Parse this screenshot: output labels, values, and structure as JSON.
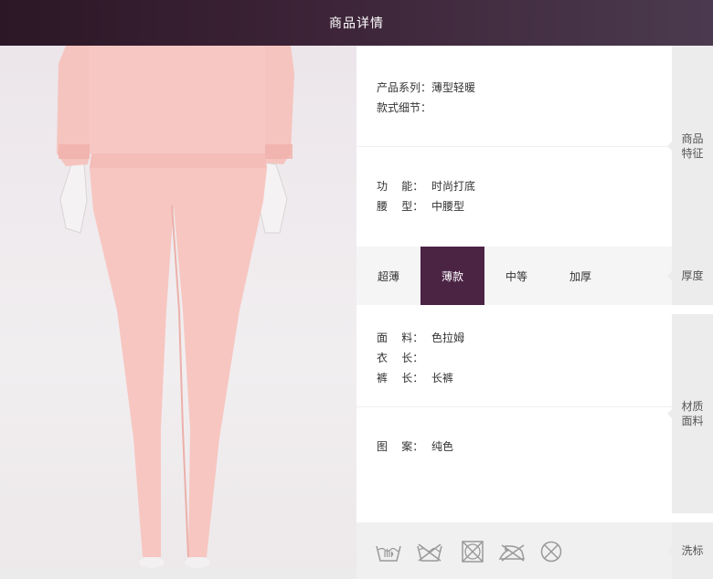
{
  "header": {
    "title": "商品详情"
  },
  "features": {
    "side_label": "商品\n特征",
    "series": {
      "label": "产品系列：",
      "value": "薄型轻暖"
    },
    "detail": {
      "label": "款式细节：",
      "value": ""
    },
    "function": {
      "label": "功    能：",
      "value": "时尚打底"
    },
    "waist": {
      "label": "腰    型：",
      "value": "中腰型"
    }
  },
  "thickness": {
    "side_label": "厚度",
    "options": [
      "超薄",
      "薄款",
      "中等",
      "加厚"
    ],
    "selected": "薄款"
  },
  "material": {
    "side_label": "材质\n面料",
    "fabric": {
      "label": "面    料：",
      "value": "色拉姆"
    },
    "top_length": {
      "label": "衣    长：",
      "value": ""
    },
    "pants_length": {
      "label": "裤    长：",
      "value": "长裤"
    },
    "pattern": {
      "label": "图    案：",
      "value": "纯色"
    }
  },
  "washing": {
    "side_label": "洗标",
    "icons": [
      "hand-wash-icon",
      "no-wash-icon",
      "no-tumble-dry-icon",
      "no-iron-icon",
      "no-dry-clean-icon"
    ]
  },
  "colors": {
    "header_dark": "#2b1726",
    "accent": "#4b2444",
    "garment_pink": "#f6c0bb",
    "side_bg": "#ececec"
  }
}
